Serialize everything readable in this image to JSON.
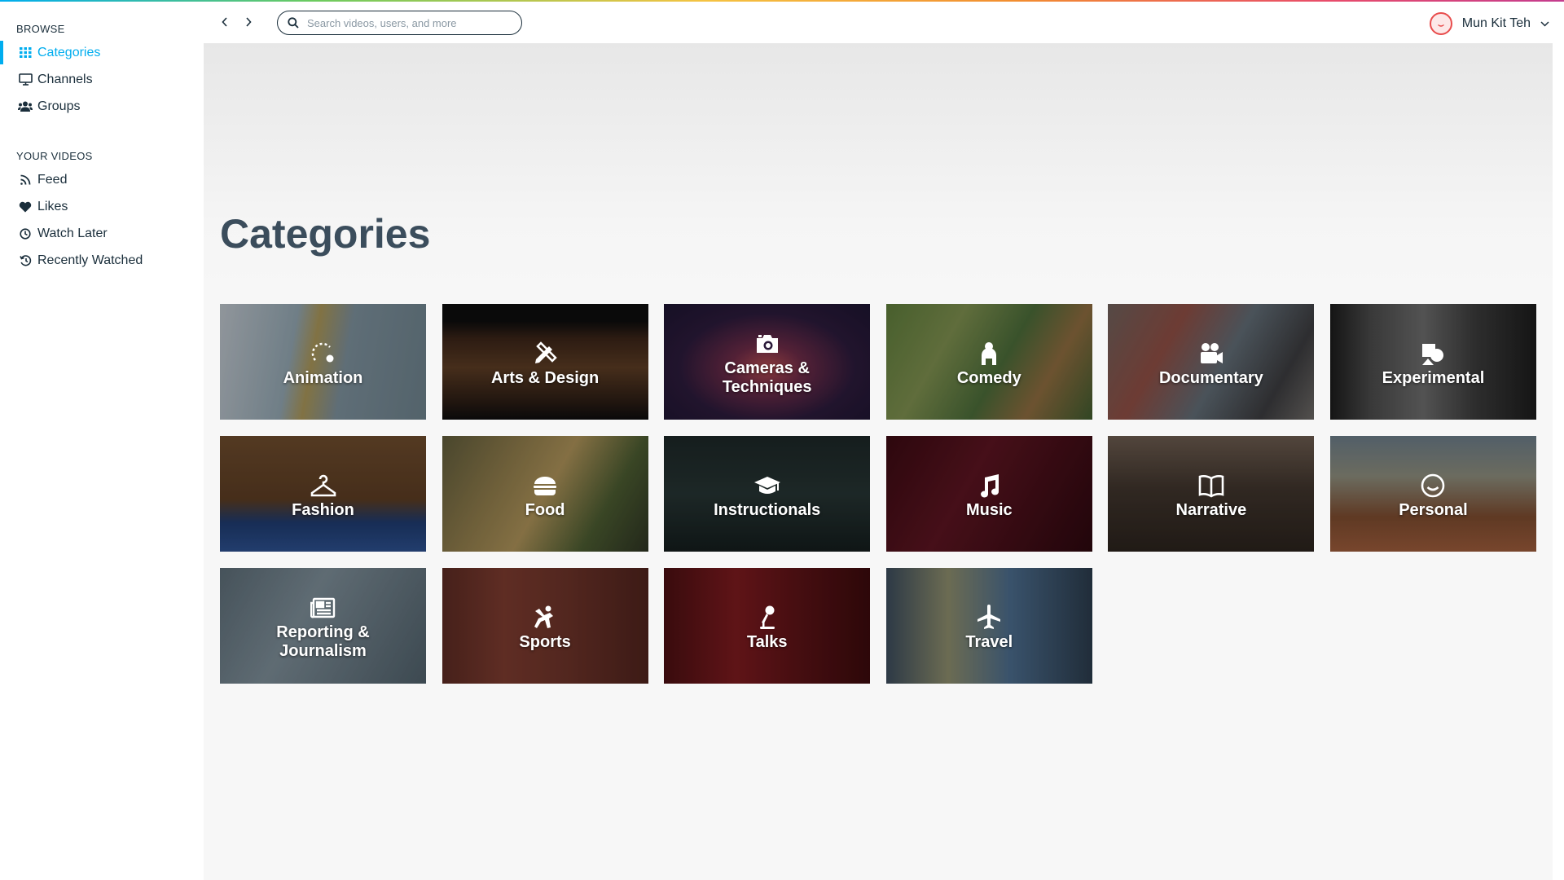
{
  "sidebar": {
    "browse_title": "BROWSE",
    "browse_items": [
      {
        "label": "Categories",
        "icon": "grid-icon",
        "active": true
      },
      {
        "label": "Channels",
        "icon": "monitor-icon"
      },
      {
        "label": "Groups",
        "icon": "users-icon"
      }
    ],
    "videos_title": "YOUR VIDEOS",
    "video_items": [
      {
        "label": "Feed",
        "icon": "rss-icon"
      },
      {
        "label": "Likes",
        "icon": "heart-icon"
      },
      {
        "label": "Watch Later",
        "icon": "clock-icon"
      },
      {
        "label": "Recently Watched",
        "icon": "history-icon"
      }
    ]
  },
  "topbar": {
    "search_placeholder": "Search videos, users, and more",
    "user_name": "Mun Kit Teh"
  },
  "main": {
    "title": "Categories",
    "categories": [
      {
        "label": "Animation",
        "icon": "animation-icon"
      },
      {
        "label": "Arts & Design",
        "icon": "pencil-ruler-icon"
      },
      {
        "label": "Cameras & Techniques",
        "icon": "camera-icon"
      },
      {
        "label": "Comedy",
        "icon": "comedy-icon"
      },
      {
        "label": "Documentary",
        "icon": "video-camera-icon"
      },
      {
        "label": "Experimental",
        "icon": "shapes-icon"
      },
      {
        "label": "Fashion",
        "icon": "hanger-icon"
      },
      {
        "label": "Food",
        "icon": "burger-icon"
      },
      {
        "label": "Instructionals",
        "icon": "graduation-cap-icon"
      },
      {
        "label": "Music",
        "icon": "music-note-icon"
      },
      {
        "label": "Narrative",
        "icon": "book-icon"
      },
      {
        "label": "Personal",
        "icon": "smiley-icon"
      },
      {
        "label": "Reporting & Journalism",
        "icon": "newspaper-icon"
      },
      {
        "label": "Sports",
        "icon": "sports-icon"
      },
      {
        "label": "Talks",
        "icon": "microphone-icon"
      },
      {
        "label": "Travel",
        "icon": "airplane-icon"
      }
    ]
  },
  "colors": {
    "accent": "#00adef",
    "text": "#1a2e3b",
    "title": "#3b4d5c",
    "avatar_ring": "#e84c4c"
  }
}
